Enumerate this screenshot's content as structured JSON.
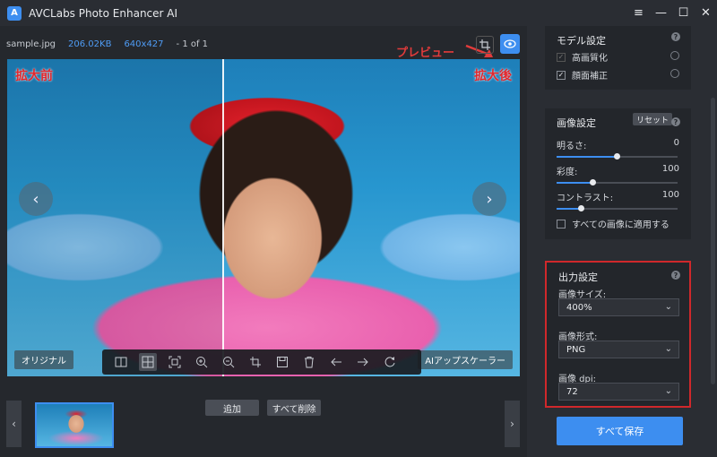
{
  "app": {
    "title": "AVCLabs Photo Enhancer AI",
    "logo_glyph": "A",
    "window_controls": [
      "≡",
      "—",
      "☐",
      "✕"
    ]
  },
  "file": {
    "name": "sample.jpg",
    "size": "206.02KB",
    "dimensions": "640x427",
    "counter": "- 1 of 1"
  },
  "annotation": {
    "preview_label": "プレビュー",
    "color": "#e23b3b"
  },
  "viewer": {
    "before_label": "拡大前",
    "after_label": "拡大後",
    "left_arrow": "‹",
    "right_arrow": "›",
    "original_badge": "オリジナル",
    "upscaler_badge": "AIアップスケーラー",
    "toolbar_icons": [
      "split-view-icon",
      "grid-view-icon",
      "fit-screen-icon",
      "zoom-in-icon",
      "zoom-out-icon",
      "crop-icon",
      "save-icon",
      "delete-icon",
      "undo-icon",
      "redo-icon",
      "refresh-icon"
    ]
  },
  "actions": {
    "add_label": "追加",
    "remove_all_label": "すべて削除"
  },
  "filmstrip": {
    "prev_arrow": "‹",
    "next_arrow": "›"
  },
  "model_settings": {
    "title": "モデル設定",
    "help": "?",
    "options": [
      {
        "label": "高画質化",
        "checked": true,
        "disabled": true
      },
      {
        "label": "顔面補正",
        "checked": true,
        "disabled": false
      }
    ]
  },
  "image_settings": {
    "title": "画像設定",
    "reset_label": "リセット",
    "help": "?",
    "sliders": [
      {
        "label": "明るさ:",
        "value": "0",
        "fraction": 0.5
      },
      {
        "label": "彩度:",
        "value": "100",
        "fraction": 0.3
      },
      {
        "label": "コントラスト:",
        "value": "100",
        "fraction": 0.2
      }
    ],
    "apply_all_label": "すべての画像に適用する",
    "apply_all_checked": false
  },
  "output_settings": {
    "title": "出力設定",
    "help": "?",
    "size_label": "画像サイズ:",
    "size_value": "400%",
    "format_label": "画像形式:",
    "format_value": "PNG",
    "dpi_label": "画像 dpi:",
    "dpi_value": "72"
  },
  "save_all_label": "すべて保存",
  "colors": {
    "accent": "#3d8ef0",
    "highlight_border": "#d0282b",
    "background": "#1f2227"
  }
}
